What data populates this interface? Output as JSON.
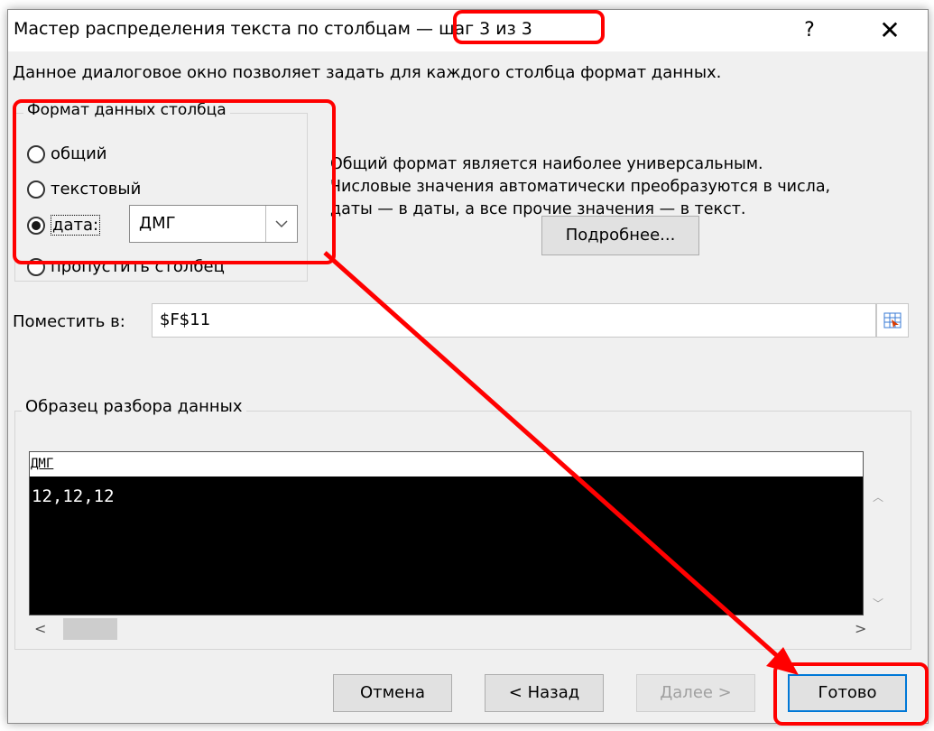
{
  "dialog": {
    "title_main": "Мастер распределения текста по столбцам — ",
    "title_step": "шаг 3 из 3",
    "help_label": "?",
    "close_label": "✕"
  },
  "description": "Данное диалоговое окно позволяет задать для каждого столбца формат данных.",
  "column_format": {
    "group_title": "Формат данных столбца",
    "options": [
      {
        "label": "общий",
        "checked": false
      },
      {
        "label": "текстовый",
        "checked": false
      },
      {
        "label": "дата:",
        "checked": true
      },
      {
        "label": "пропустить столбец",
        "checked": false
      }
    ],
    "date_format_value": "ДМГ"
  },
  "info": {
    "lines": [
      "Общий формат является наиболее универсальным.",
      "Числовые значения автоматически преобразуются в числа,",
      "даты — в даты, а все прочие значения — в текст."
    ],
    "more_button": "Подробнее..."
  },
  "destination": {
    "label": "Поместить в:",
    "value": "$F$11"
  },
  "preview": {
    "title": "Образец разбора данных",
    "header": "ДМГ",
    "rows": [
      "12,12,12"
    ]
  },
  "buttons": {
    "cancel": "Отмена",
    "back": "< Назад",
    "next": "Далее >",
    "finish": "Готово"
  },
  "annotation_color": "#ff0000"
}
